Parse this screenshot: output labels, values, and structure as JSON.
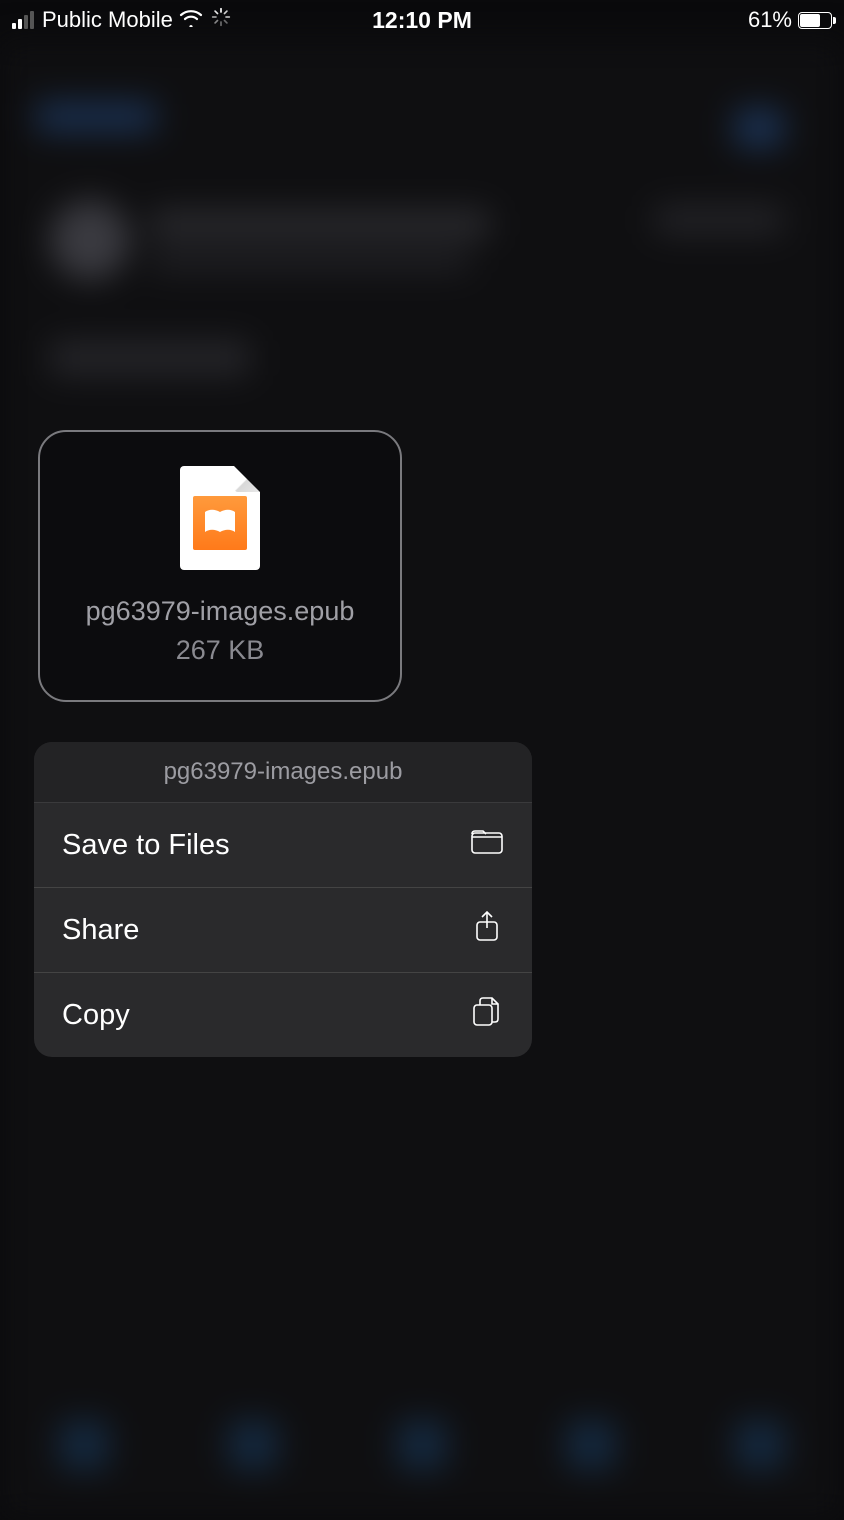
{
  "status_bar": {
    "carrier": "Public Mobile",
    "time": "12:10 PM",
    "battery_pct": "61%"
  },
  "file_preview": {
    "name": "pg63979-images.epub",
    "size": "267 KB"
  },
  "menu": {
    "title": "pg63979-images.epub",
    "items": [
      {
        "label": "Save to Files"
      },
      {
        "label": "Share"
      },
      {
        "label": "Copy"
      }
    ]
  }
}
